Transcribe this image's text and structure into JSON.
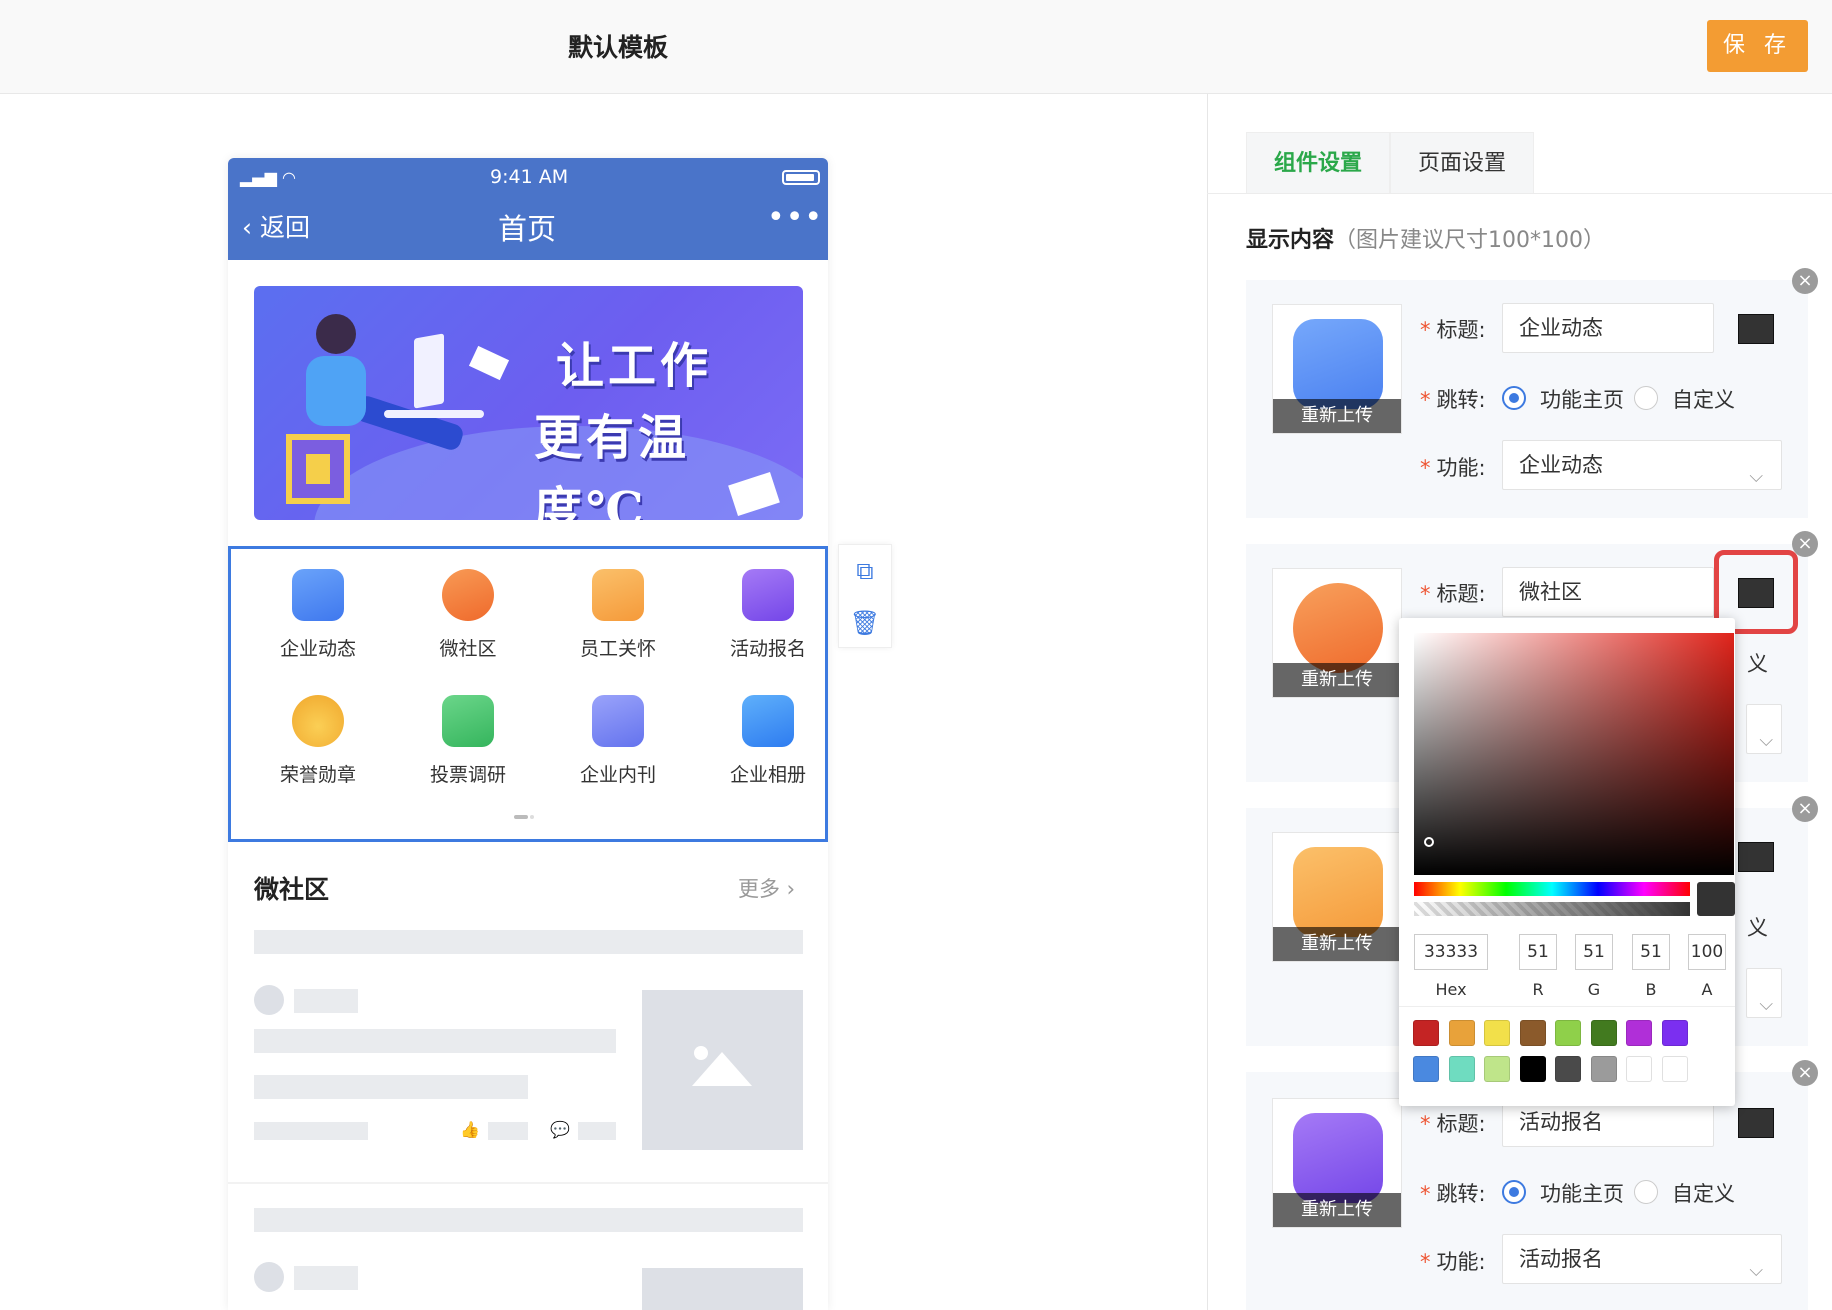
{
  "header": {
    "title": "默认模板",
    "save_label": "保 存"
  },
  "phone": {
    "status": {
      "time": "9:41 AM",
      "signal": "📶"
    },
    "nav": {
      "back": "返回",
      "title": "首页",
      "more": "•••"
    },
    "banner": {
      "line1": "让工作",
      "line2": "更有温度℃"
    },
    "grid": [
      {
        "label": "企业动态",
        "icon": "document-icon",
        "color": "#4f8df5"
      },
      {
        "label": "微社区",
        "icon": "chat-bubble-icon",
        "color": "#f2753a"
      },
      {
        "label": "员工关怀",
        "icon": "gift-icon",
        "color": "#f5a548"
      },
      {
        "label": "活动报名",
        "icon": "star-badge-icon",
        "color": "#8a5bf0"
      },
      {
        "label": "荣誉勋章",
        "icon": "medal-icon",
        "color": "#f5b93a"
      },
      {
        "label": "投票调研",
        "icon": "ballot-box-icon",
        "color": "#48c26a"
      },
      {
        "label": "企业内刊",
        "icon": "book-icon",
        "color": "#7a86f5"
      },
      {
        "label": "企业相册",
        "icon": "photo-icon",
        "color": "#3d8df5"
      }
    ],
    "section": {
      "title": "微社区",
      "more": "更多"
    }
  },
  "panel": {
    "tabs": [
      {
        "label": "组件设置",
        "active": true
      },
      {
        "label": "页面设置",
        "active": false
      }
    ],
    "display": {
      "title": "显示内容",
      "hint": "（图片建议尺寸100*100）"
    },
    "reupload": "重新上传",
    "labels": {
      "title": "标题:",
      "jump": "跳转:",
      "func": "功能:",
      "req": "*"
    },
    "radio": {
      "home": "功能主页",
      "custom": "自定义"
    },
    "cards": [
      {
        "title_value": "企业动态",
        "func_value": "企业动态",
        "icon": "document-icon",
        "color": "#5b8ef7"
      },
      {
        "title_value": "微社区",
        "func_value": "",
        "icon": "chat-bubble-icon",
        "color": "#f47a35"
      },
      {
        "title_value": "",
        "func_value": "",
        "icon": "gift-icon",
        "color": "#f5a548"
      },
      {
        "title_value": "活动报名",
        "func_value": "活动报名",
        "icon": "star-badge-icon",
        "color": "#8a5bf0"
      }
    ]
  },
  "picker": {
    "hex": "33333",
    "r": "51",
    "g": "51",
    "b": "51",
    "a": "100",
    "labels": {
      "hex": "Hex",
      "r": "R",
      "g": "G",
      "b": "B",
      "a": "A"
    },
    "swatches": [
      "#c42424",
      "#e8a23a",
      "#f2e04a",
      "#8b5a2b",
      "#8fd04a",
      "#427a1f",
      "#b02fd8",
      "#7b2ff0",
      "#4a89e0",
      "#6fdcc0",
      "#bfe58a",
      "#000000",
      "#4a4a4a",
      "#9b9b9b",
      "#ffffff",
      "#ffffff"
    ],
    "current_color": "#333333"
  }
}
